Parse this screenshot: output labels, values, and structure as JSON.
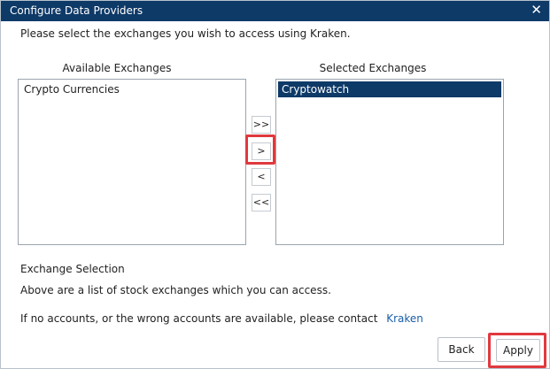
{
  "dialog": {
    "title": "Configure Data Providers"
  },
  "instructions": "Please select the exchanges you wish to access using Kraken.",
  "available": {
    "label": "Available Exchanges",
    "items": [
      "Crypto Currencies"
    ]
  },
  "selected": {
    "label": "Selected Exchanges",
    "items": [
      "Cryptowatch"
    ]
  },
  "move_buttons": {
    "add_all": ">>",
    "add": ">",
    "remove": "<",
    "remove_all": "<<"
  },
  "info": {
    "heading": "Exchange Selection",
    "description": "Above are a list of stock exchanges which you can access.",
    "contact_text": "If no accounts, or the wrong accounts are available, please contact",
    "contact_link": "Kraken"
  },
  "buttons": {
    "back": "Back",
    "apply": "Apply"
  },
  "icons": {
    "close": "close-icon"
  },
  "colors": {
    "titlebar": "#0e3a68",
    "highlight": "#e0393e",
    "link": "#1a5ea8"
  }
}
